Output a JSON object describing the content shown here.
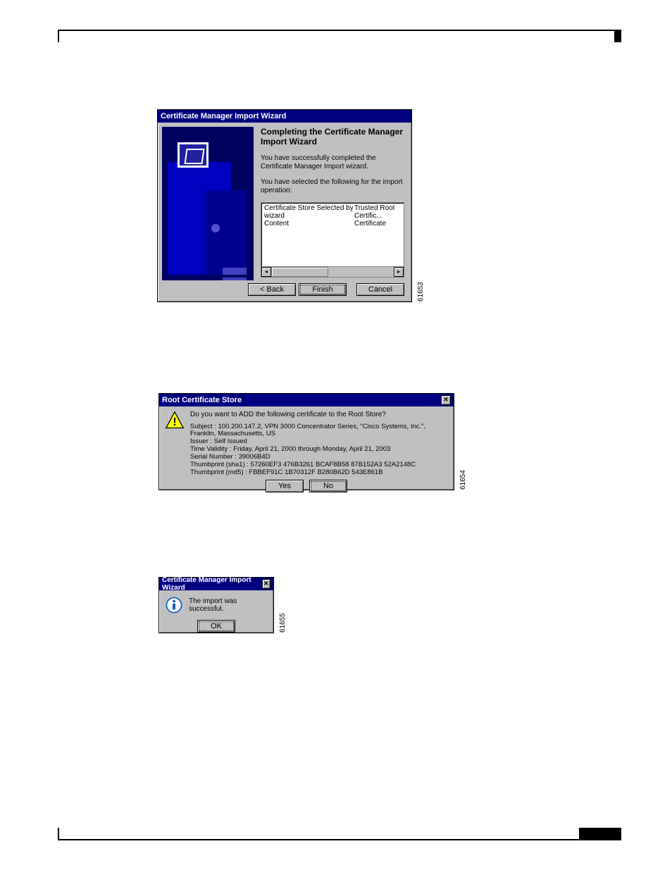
{
  "dlg1": {
    "title": "Certificate Manager Import Wizard",
    "heading": "Completing the Certificate Manager Import Wizard",
    "line1": "You have successfully completed the Certificate Manager Import wizard.",
    "line2": "You have selected the following for the import operation:",
    "rows": [
      {
        "label": "Certificate Store Selected by wizard",
        "value": "Trusted Root Certific..."
      },
      {
        "label": "Content",
        "value": "Certificate"
      }
    ],
    "buttons": {
      "back": "< Back",
      "finish": "Finish",
      "cancel": "Cancel"
    },
    "image_id": "61653"
  },
  "dlg2": {
    "title": "Root Certificate Store",
    "question": "Do you want to ADD the following certificate to the Root Store?",
    "subject": "Subject : 100.200.147.2, VPN 3000 Concentrator Series, \"Cisco Systems, Inc.\", Franklin, Massachusetts, US",
    "issuer": "Issuer : Self Issued",
    "validity": "Time Validity : Friday, April 21, 2000 through Monday, April 21, 2003",
    "serial": "Serial Number : 39006B4D",
    "sha1": "Thumbprint (sha1) : 57260EF3 476B3261 BCAF8B58 87B152A3 52A2148C",
    "md5": "Thumbprint (md5) : FBBEF91C 1B70312F B280B62D 543E861B",
    "buttons": {
      "yes": "Yes",
      "no": "No"
    },
    "image_id": "61654"
  },
  "dlg3": {
    "title": "Certificate Manager Import Wizard",
    "message": "The import was successful.",
    "buttons": {
      "ok": "OK"
    },
    "image_id": "61655"
  }
}
